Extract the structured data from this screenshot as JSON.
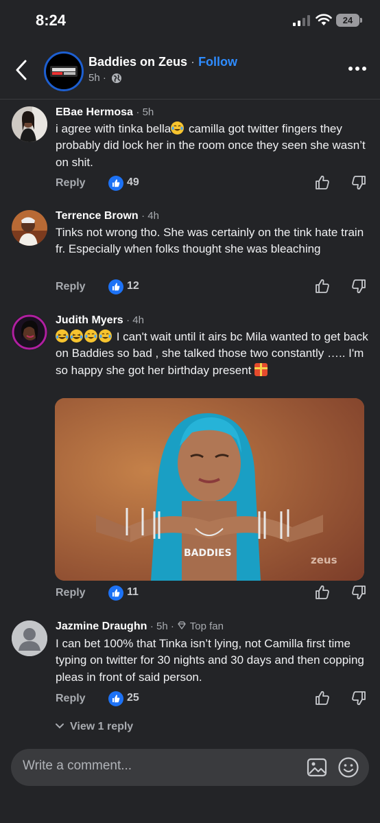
{
  "status_bar": {
    "time": "8:24",
    "battery": "24"
  },
  "header": {
    "page_name": "Baddies on Zeus",
    "separator": "·",
    "follow_label": "Follow",
    "meta_time": "5h ·"
  },
  "comments": [
    {
      "author": "EBae Hermosa",
      "time": "· 5h",
      "text_before_emoji": "i agree with tinka bella",
      "text_after_emoji": " camilla got twitter fingers they probably did lock her in the room once they seen she wasn’t on shit.",
      "reply_label": "Reply",
      "likes": "49"
    },
    {
      "author": "Terrence Brown",
      "time": "· 4h",
      "text": "Tinks not wrong tho. She was certainly on the tink hate train fr. Especially when folks thought she was bleaching",
      "reply_label": "Reply",
      "likes": "12"
    },
    {
      "author": "Judith Myers",
      "time": "· 4h",
      "text": " I can't wait until it airs bc Mila wanted to get back on Baddies so bad , she talked those two constantly ….. I'm so happy she got her birthday present ",
      "image_watermark": "zeus",
      "image_necklace": "BADDIES",
      "reply_label": "Reply",
      "likes": "11"
    },
    {
      "author": "Jazmine Draughn",
      "time": "· 5h ·",
      "badge": "Top fan",
      "text": "I can bet 100% that Tinka isn’t lying, not Camilla first time typing on twitter for 30 nights and 30 days and then copping pleas in front of said person.",
      "reply_label": "Reply",
      "likes": "25"
    }
  ],
  "view_replies": "View 1 reply",
  "composer": {
    "placeholder": "Write a comment..."
  },
  "colors": {
    "background": "#232427",
    "accent": "#2e8cff",
    "like_badge": "#1d72f5"
  }
}
